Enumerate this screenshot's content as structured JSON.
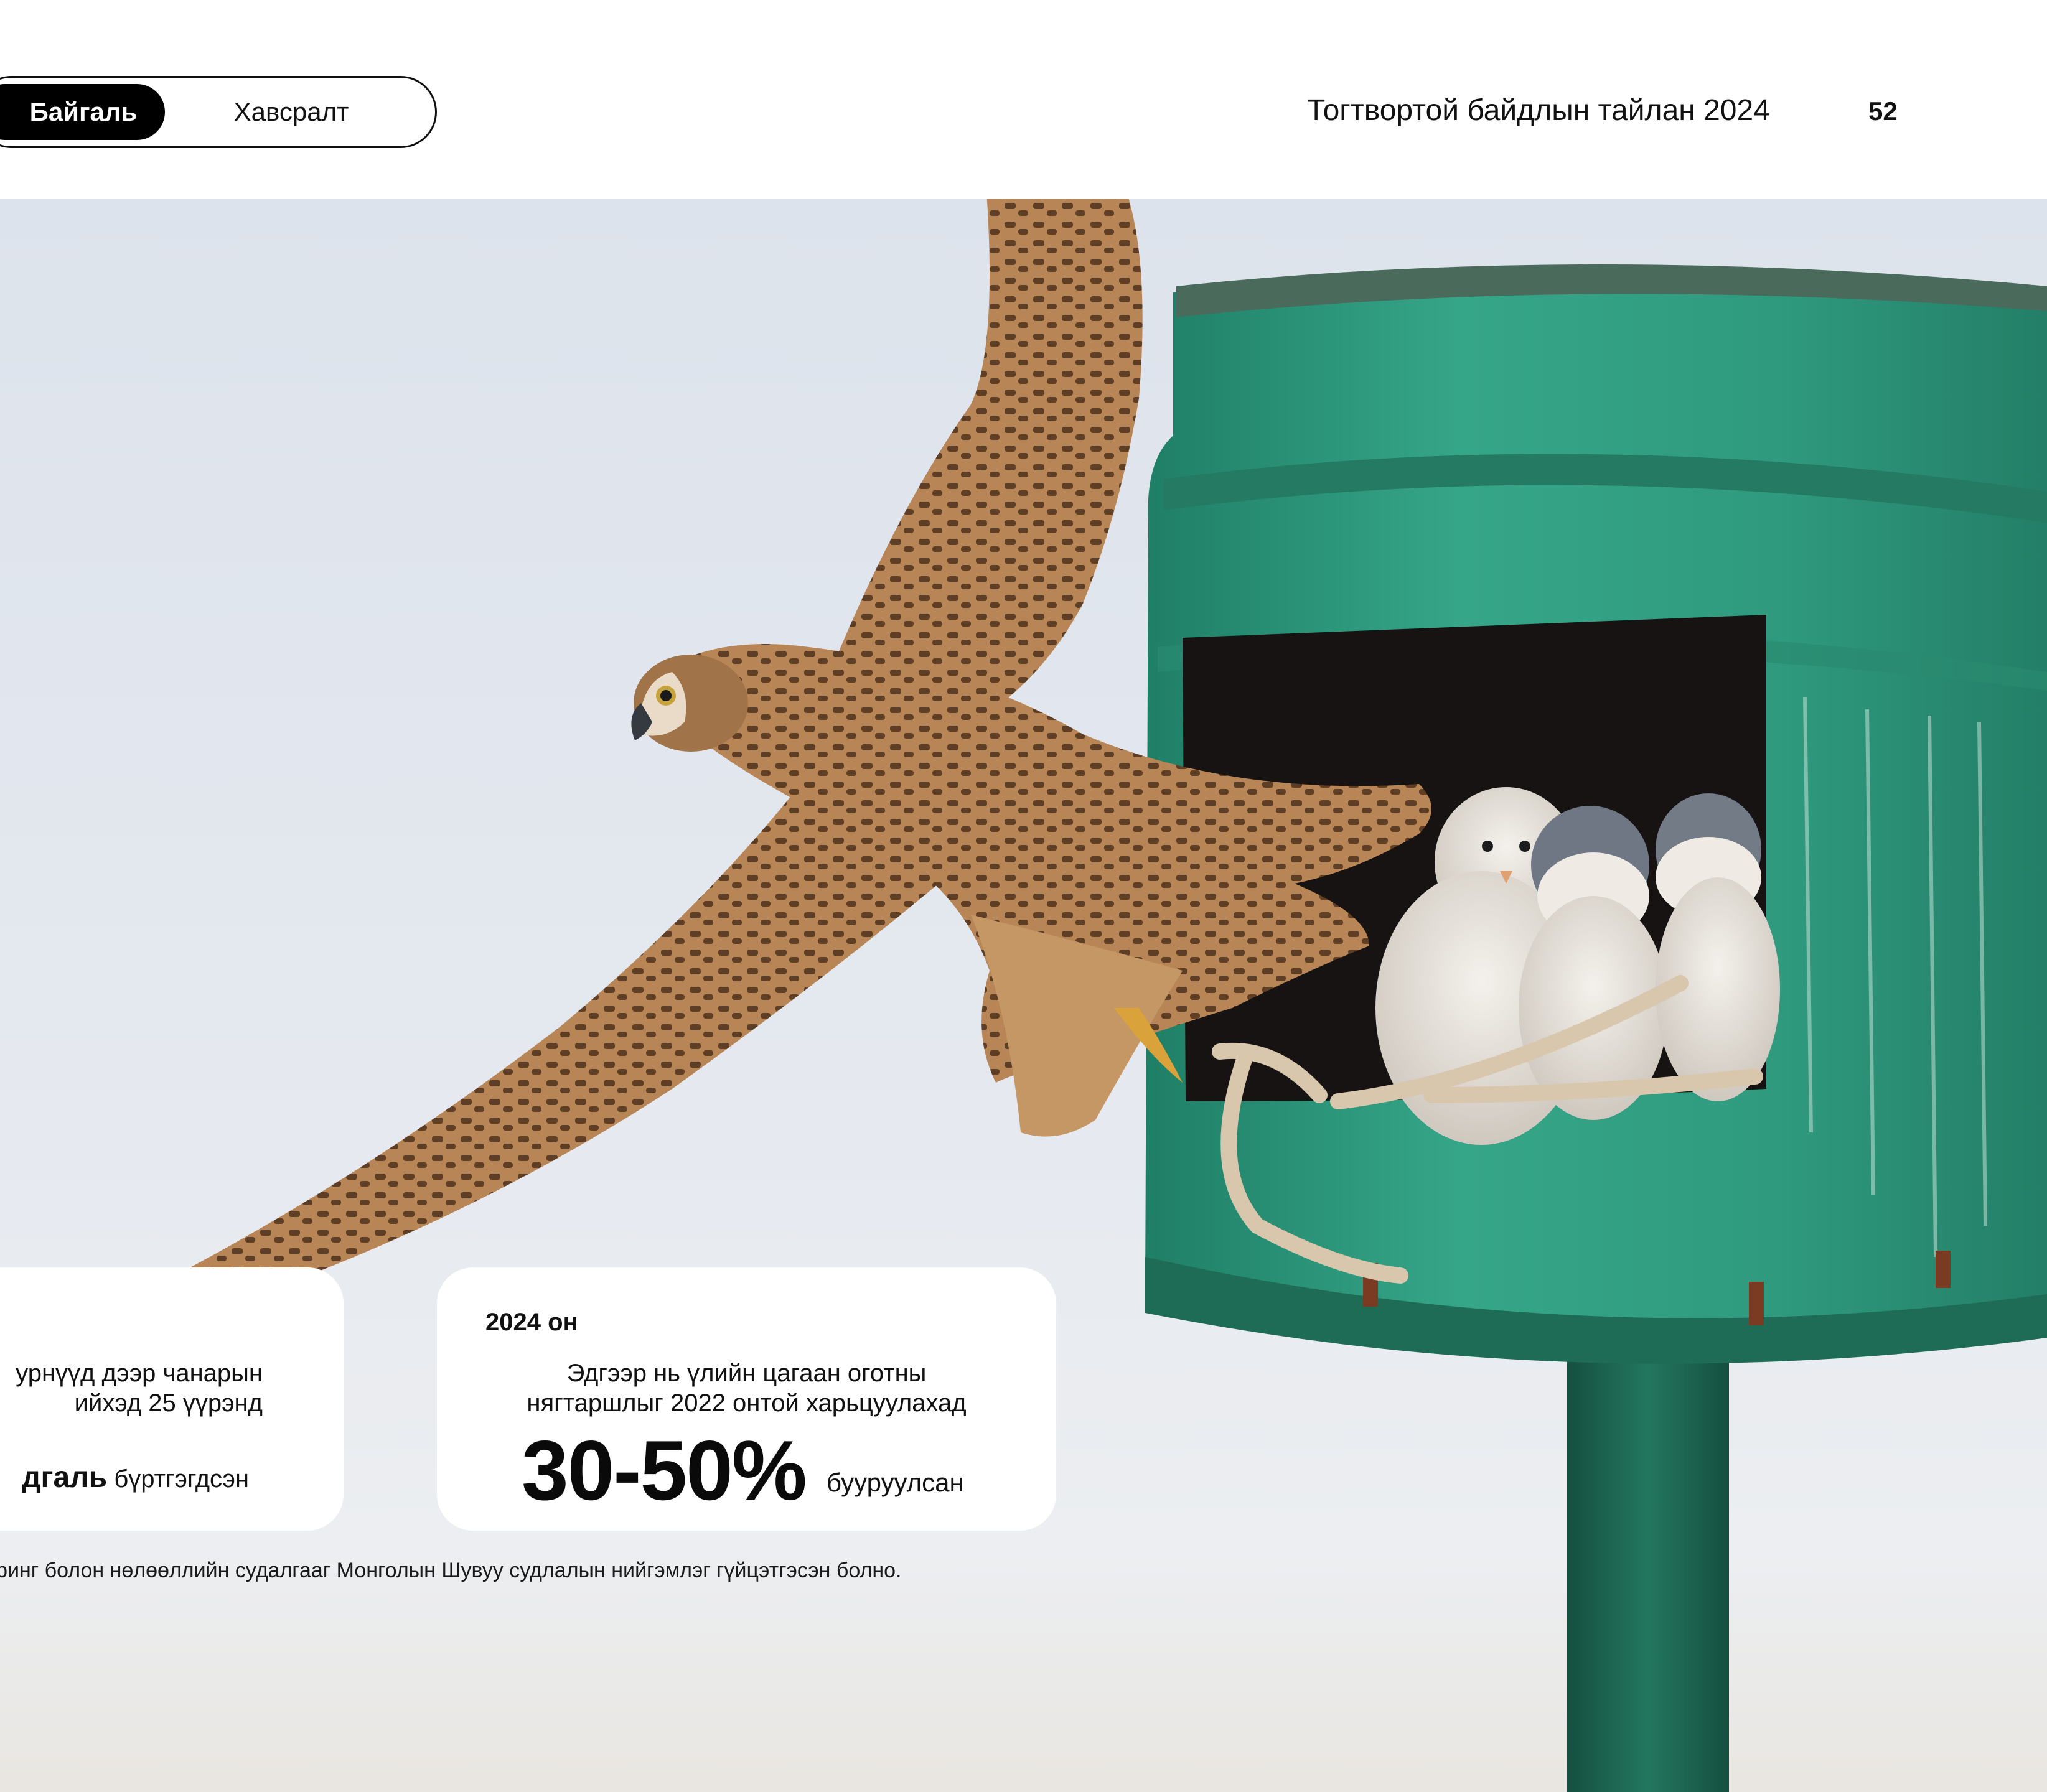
{
  "header": {
    "tabs": [
      {
        "label": "Байгаль",
        "active": true
      },
      {
        "label": "Хавсралт",
        "active": false
      }
    ],
    "report_title": "Тогтвортой байдлын тайлан 2024",
    "page_number": "52"
  },
  "cards": {
    "left": {
      "line1": "урнүүд дээр чанарын",
      "line2": "ийхэд 25 үүрэнд",
      "bold": "дгаль",
      "suffix": "бүртгэгдсэн"
    },
    "right": {
      "year": "2024 он",
      "desc_line1": "Эдгээр нь үлийн цагаан оготны",
      "desc_line2": "нягтаршлыг 2022 онтой харьцуулахад",
      "big_value": "30-50%",
      "suffix": "бууруулсан"
    }
  },
  "footnote": "иторинг болон нөлөөллийн судалгааг Монголын Шувуу судлалын нийгэмлэг гүйцэтгэсэн болно.",
  "colors": {
    "nest_box": "#2f9a7e",
    "pole": "#1f6e58",
    "sky": "#dde3ec",
    "falcon": "#9b7048"
  }
}
